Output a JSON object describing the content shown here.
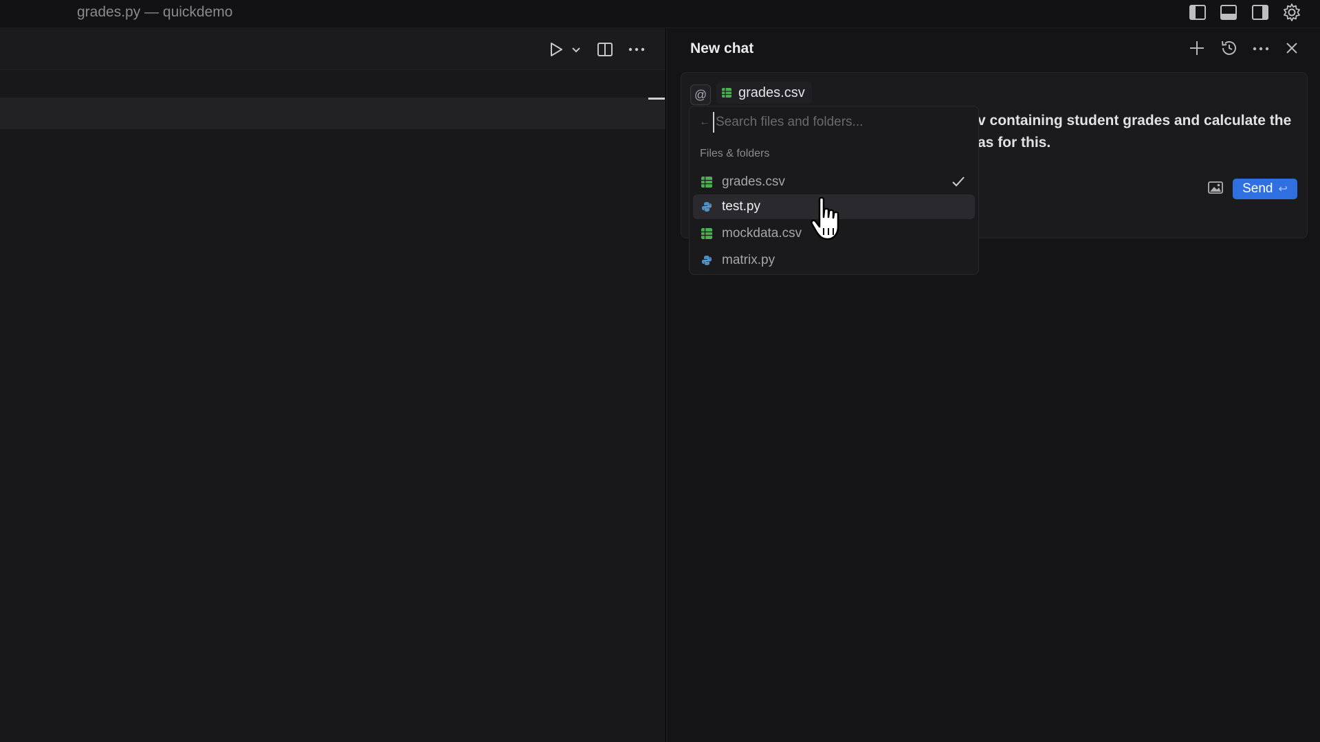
{
  "window": {
    "title": "grades.py — quickdemo"
  },
  "title_bar_icons": [
    "sidebar-left-icon",
    "panel-bottom-icon",
    "sidebar-right-icon",
    "gear-icon"
  ],
  "editor_toolbar": {
    "icons": [
      "play-icon",
      "chevron-down-icon",
      "split-editor-icon",
      "more-icon"
    ]
  },
  "chat": {
    "title": "New chat",
    "header_icons": [
      "plus-icon",
      "history-icon",
      "more-icon",
      "close-icon"
    ],
    "at_symbol": "@",
    "attached_file": "grades.csv",
    "message_lines": [
      "v containing student grades and calculate the",
      "as for this."
    ],
    "send_label": "Send",
    "send_shortcut": "↩",
    "accent_color": "#2f6fe0"
  },
  "file_picker": {
    "back_arrow": "←",
    "search_placeholder": "Search files and folders...",
    "section_label": "Files & folders",
    "items": [
      {
        "name": "grades.csv",
        "type": "csv",
        "selected": true,
        "highlighted": false
      },
      {
        "name": "test.py",
        "type": "python",
        "selected": false,
        "highlighted": true
      },
      {
        "name": "mockdata.csv",
        "type": "csv",
        "selected": false,
        "highlighted": false
      },
      {
        "name": "matrix.py",
        "type": "python",
        "selected": false,
        "highlighted": false
      }
    ],
    "csv_icon_color": "#4caf50",
    "python_icon_color": "#4a90c8"
  }
}
